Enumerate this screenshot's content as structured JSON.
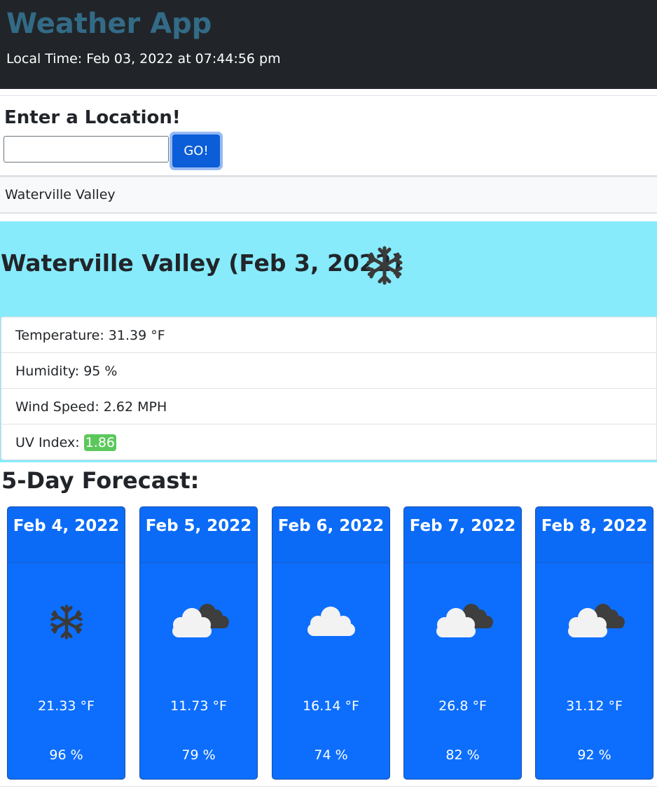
{
  "header": {
    "title": "Weather App",
    "local_time": "Local Time: Feb 03, 2022 at 07:44:56 pm"
  },
  "search": {
    "heading": "Enter a Location!",
    "value": "",
    "placeholder": "",
    "go_label": "GO!"
  },
  "history": [
    {
      "label": "Waterville Valley"
    }
  ],
  "current": {
    "title": "Waterville Valley (Feb 3, 2022)",
    "icon": "snowflake-icon",
    "temperature": "Temperature: 31.39 °F",
    "humidity": "Humidity: 95 %",
    "wind": "Wind Speed: 2.62 MPH",
    "uv_label": "UV Index: ",
    "uv_value": "1.86",
    "uv_color": "#5cc85c",
    "panel_color": "#87ebfc"
  },
  "forecast": {
    "heading": "5-Day Forecast:",
    "card_color": "#0d6efd",
    "days": [
      {
        "date": "Feb 4, 2022",
        "icon": "snowflake-icon",
        "temp": "21.33 °F",
        "humidity": "96 %"
      },
      {
        "date": "Feb 5, 2022",
        "icon": "cloud-dark-cloud-icon",
        "temp": "11.73 °F",
        "humidity": "79 %"
      },
      {
        "date": "Feb 6, 2022",
        "icon": "cloud-icon",
        "temp": "16.14 °F",
        "humidity": "74 %"
      },
      {
        "date": "Feb 7, 2022",
        "icon": "cloud-dark-cloud-icon",
        "temp": "26.8 °F",
        "humidity": "82 %"
      },
      {
        "date": "Feb 8, 2022",
        "icon": "cloud-dark-cloud-icon",
        "temp": "31.12 °F",
        "humidity": "92 %"
      }
    ]
  }
}
